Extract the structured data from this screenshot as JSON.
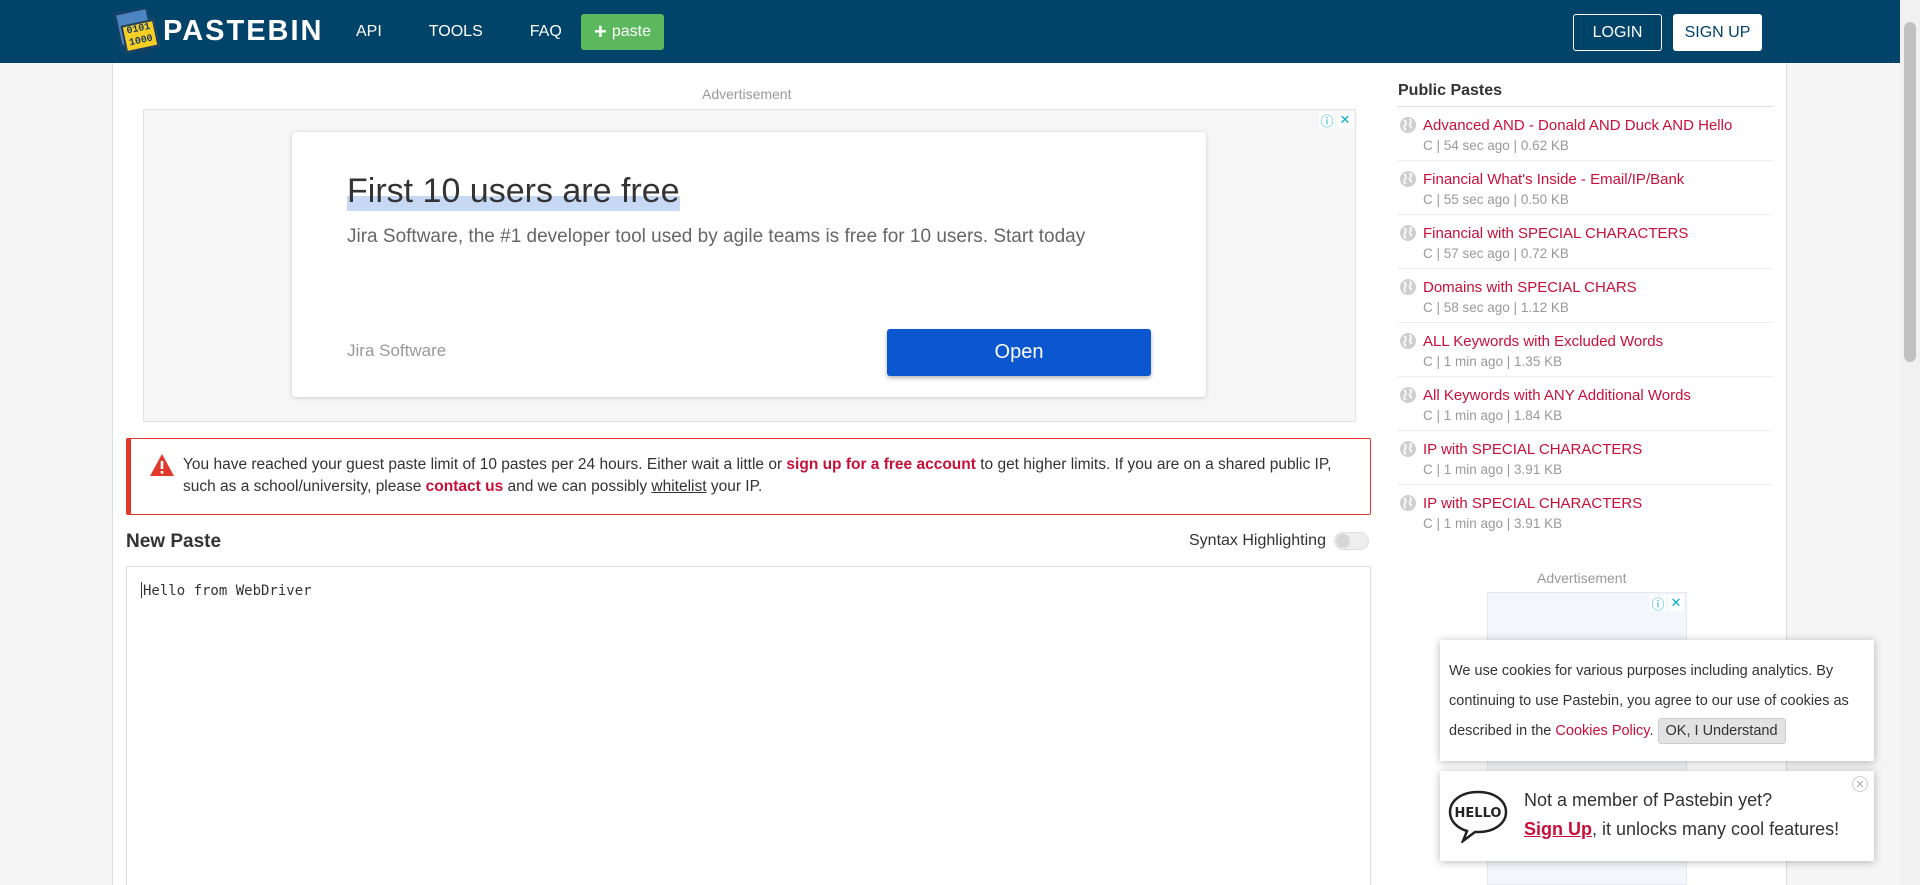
{
  "header": {
    "logo_text": "PASTEBIN",
    "logo_badge": [
      "0101",
      "1000",
      "101"
    ],
    "nav": [
      "API",
      "TOOLS",
      "FAQ"
    ],
    "paste_button": "paste",
    "login": "LOGIN",
    "signup": "SIGN UP"
  },
  "ad": {
    "label": "Advertisement",
    "headline": "First 10 users are free",
    "description": "Jira Software, the #1 developer tool used by agile teams is free for 10 users. Start today",
    "brand": "Jira Software",
    "cta": "Open"
  },
  "notice": {
    "part1": "You have reached your guest paste limit of 10 pastes per 24 hours. Either wait a little or ",
    "signup_link": "sign up for a free account",
    "part2": " to get higher limits. If you are on a shared public IP, such as a school/university, please ",
    "contact_link": "contact us",
    "part3": " and we can possibly ",
    "whitelist_link": "whitelist",
    "part4": " your IP."
  },
  "new_paste": {
    "title": "New Paste",
    "syntax_label": "Syntax Highlighting",
    "content": "Hello from WebDriver"
  },
  "public_pastes": {
    "title": "Public Pastes",
    "items": [
      {
        "title": "Advanced AND - Donald AND Duck AND Hello",
        "meta": "C | 54 sec ago | 0.62 KB"
      },
      {
        "title": "Financial What's Inside - Email/IP/Bank",
        "meta": "C | 55 sec ago | 0.50 KB"
      },
      {
        "title": "Financial with SPECIAL CHARACTERS",
        "meta": "C | 57 sec ago | 0.72 KB"
      },
      {
        "title": "Domains with SPECIAL CHARS",
        "meta": "C | 58 sec ago | 1.12 KB"
      },
      {
        "title": "ALL Keywords with Excluded Words",
        "meta": "C | 1 min ago | 1.35 KB"
      },
      {
        "title": "All Keywords with ANY Additional Words",
        "meta": "C | 1 min ago | 1.84 KB"
      },
      {
        "title": "IP with SPECIAL CHARACTERS",
        "meta": "C | 1 min ago | 3.91 KB"
      },
      {
        "title": "IP with SPECIAL CHARACTERS",
        "meta": "C | 1 min ago | 3.91 KB"
      }
    ]
  },
  "sidebar_ad": {
    "label": "Advertisement"
  },
  "cookie": {
    "text": "We use cookies for various purposes including analytics. By continuing to use Pastebin, you agree to our use of cookies as described in the ",
    "link": "Cookies Policy",
    "after": ".",
    "ok": "OK, I Understand"
  },
  "member": {
    "badge": "HELLO",
    "line1": "Not a member of Pastebin yet?",
    "signup": "Sign Up",
    "line2_rest": ", it unlocks many cool features!"
  },
  "colors": {
    "header_bg": "#02436a",
    "paste_green": "#5cb85c",
    "link_red": "#c70f3a",
    "ad_blue": "#0b57d0"
  }
}
